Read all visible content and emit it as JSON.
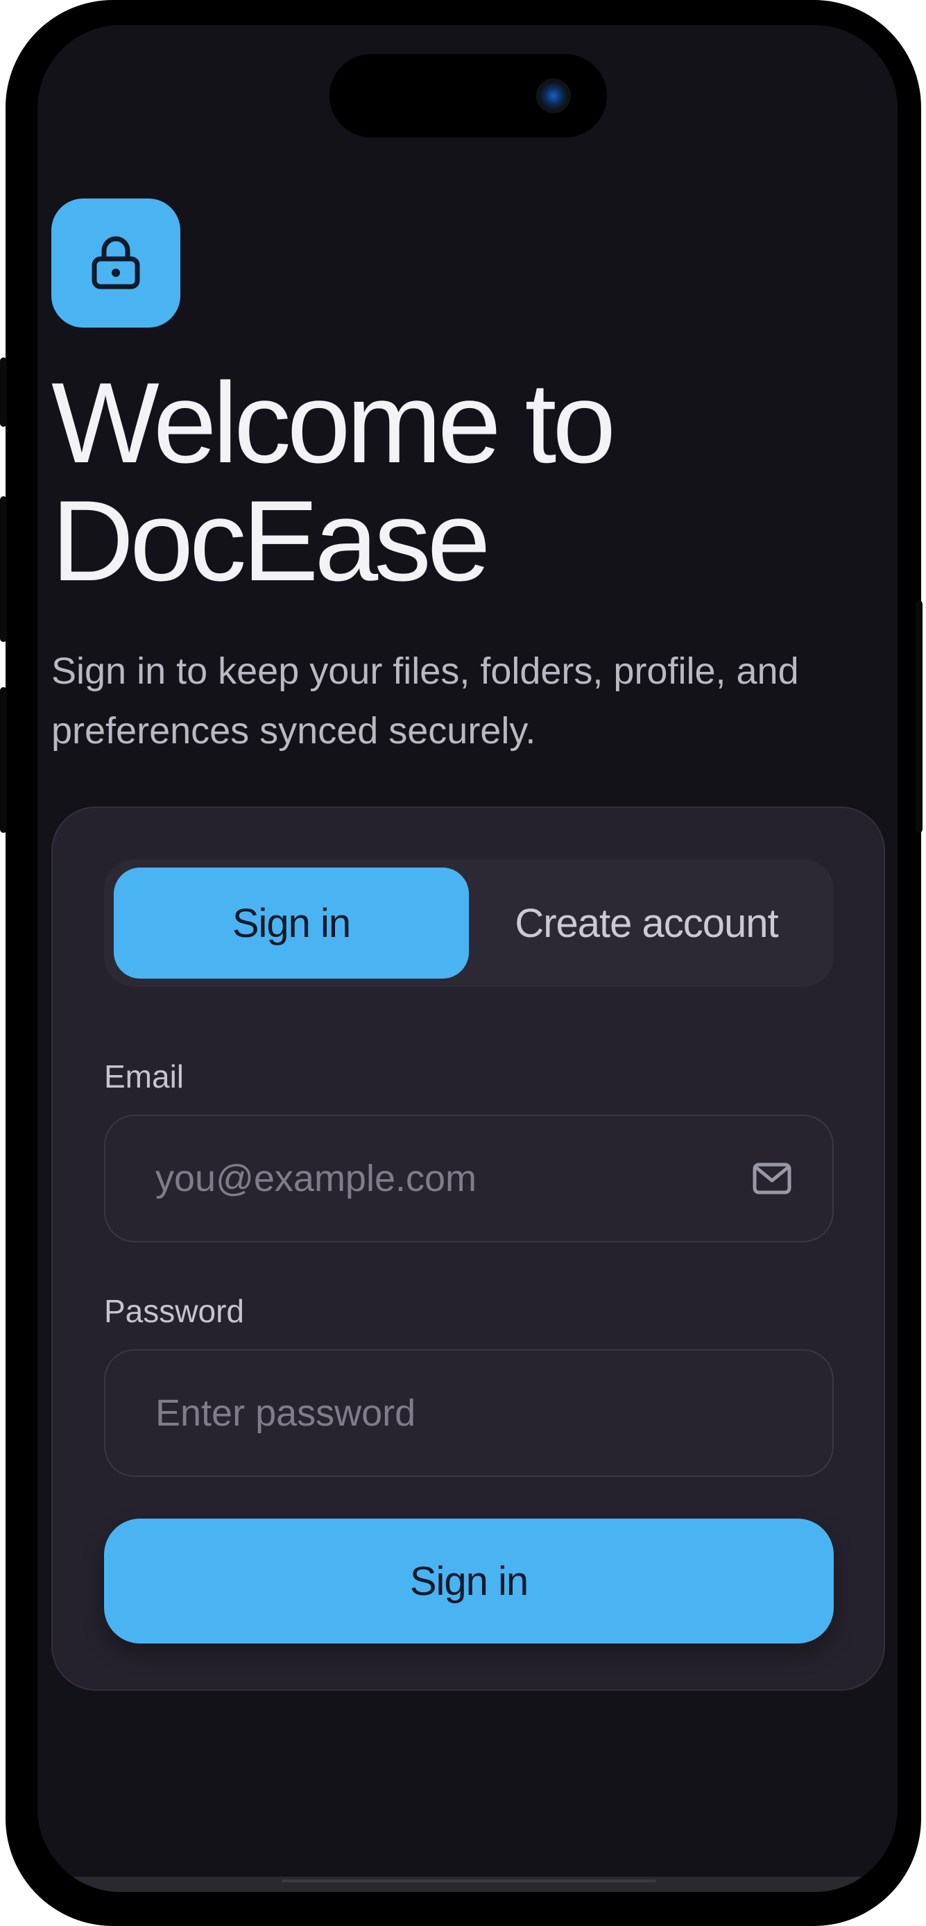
{
  "app": {
    "title_line1": "Welcome to",
    "title_line2": "DocEase",
    "subtitle": "Sign in to keep your files, folders, profile, and preferences synced securely.",
    "logo_icon": "lock-icon"
  },
  "auth_tabs": {
    "sign_in_label": "Sign in",
    "create_account_label": "Create account",
    "active": "Sign in"
  },
  "form": {
    "email_label": "Email",
    "email_placeholder": "you@example.com",
    "email_value": "",
    "email_icon": "mail-icon",
    "password_label": "Password",
    "password_placeholder": "Enter password",
    "password_value": "",
    "submit_label": "Sign in"
  },
  "colors": {
    "accent": "#4ab4f3",
    "background": "#121218",
    "card": "#25222d",
    "text_primary": "#f3f3f6",
    "text_secondary": "#b9b8c3"
  }
}
